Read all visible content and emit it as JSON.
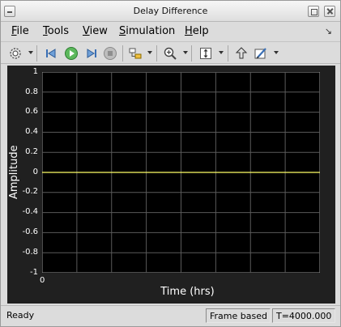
{
  "window": {
    "title": "Delay Difference"
  },
  "menubar": {
    "items": [
      {
        "label": "File",
        "mnemonic": "F",
        "rest": "ile"
      },
      {
        "label": "Tools",
        "mnemonic": "T",
        "rest": "ools"
      },
      {
        "label": "View",
        "mnemonic": "V",
        "rest": "iew"
      },
      {
        "label": "Simulation",
        "mnemonic": "S",
        "rest": "imulation"
      },
      {
        "label": "Help",
        "mnemonic": "H",
        "rest": "elp"
      }
    ]
  },
  "toolbar": {
    "icons": [
      "settings-gear-icon",
      "step-back-icon",
      "run-icon",
      "step-forward-icon",
      "stop-icon",
      "highlight-block-icon",
      "zoom-in-icon",
      "scale-axes-icon",
      "restore-view-icon",
      "style-icon"
    ]
  },
  "plot": {
    "ylabel": "Amplitude",
    "xlabel": "Time (hrs)",
    "y_ticks": [
      "1",
      "0.8",
      "0.6",
      "0.4",
      "0.2",
      "0",
      "-0.2",
      "-0.4",
      "-0.6",
      "-0.8",
      "-1"
    ],
    "x_ticks": [
      "0"
    ],
    "colors": {
      "background": "#000000",
      "grid": "#5a5a5a",
      "signal": "#ffff66"
    }
  },
  "chart_data": {
    "type": "line",
    "title": "",
    "xlabel": "Time (hrs)",
    "ylabel": "Amplitude",
    "ylim": [
      -1,
      1
    ],
    "grid": true,
    "series": [
      {
        "x": [
          0,
          10
        ],
        "y": [
          0,
          0
        ]
      }
    ]
  },
  "status": {
    "ready": "Ready",
    "mode": "Frame based",
    "time": "T=4000.000"
  }
}
